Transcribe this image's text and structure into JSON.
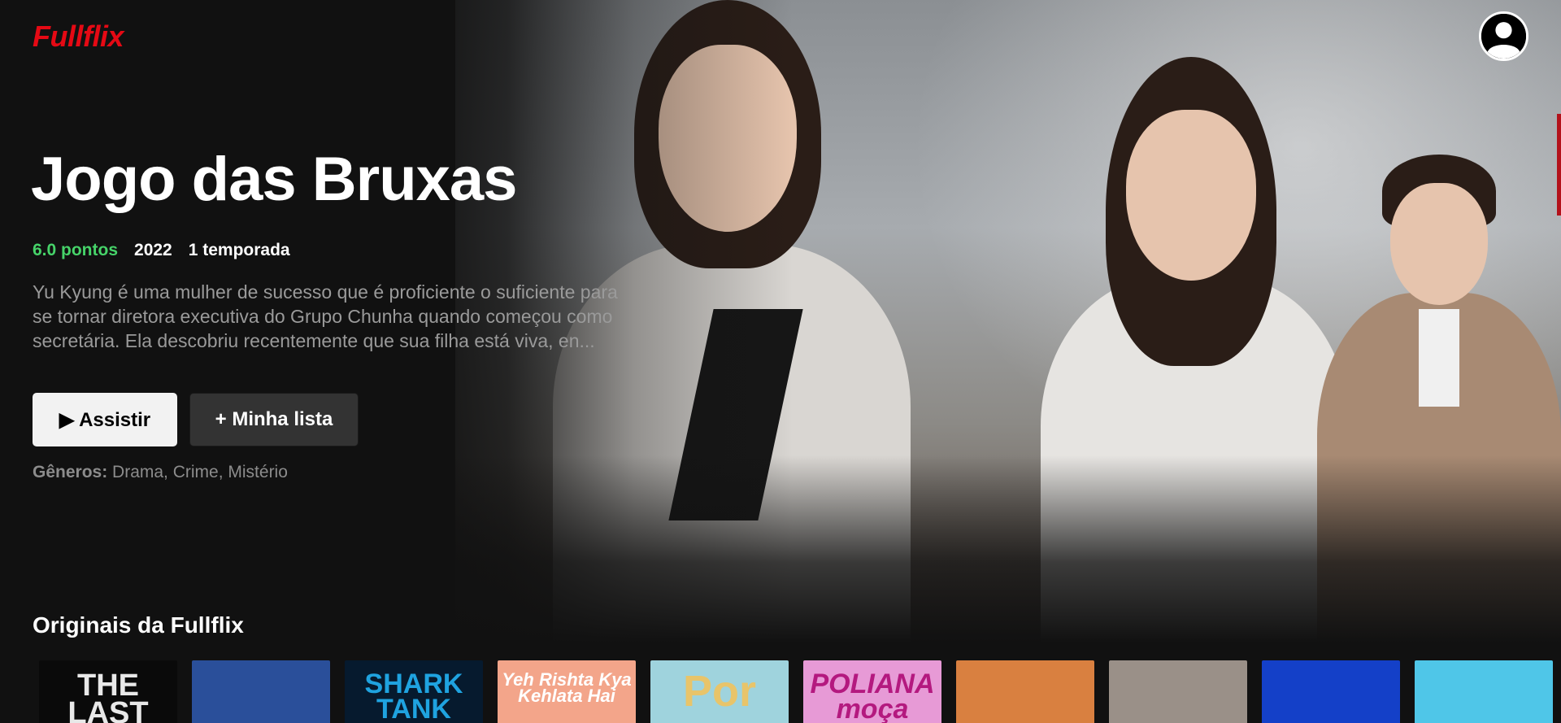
{
  "app": {
    "logo": "Fullflix"
  },
  "header": {
    "profile_icon": "user-circle-icon"
  },
  "featured": {
    "title": "Jogo das Bruxas",
    "score": "6.0 pontos",
    "year": "2022",
    "seasons": "1 temporada",
    "description": "Yu Kyung é uma mulher de sucesso que é proficiente o suficiente para se tornar diretora executiva do Grupo Chunha quando começou como secretária. Ela descobriu recentemente que sua filha está viva, en...",
    "play_label": "▶ Assistir",
    "list_label": "+ Minha lista",
    "genres_label": "Gêneros:",
    "genres": "Drama, Crime, Mistério"
  },
  "row": {
    "title": "Originais da Fullflix",
    "items": [
      {
        "text": "THE LAST",
        "bg": "#0a0a0a",
        "fg": "#e8e8e8"
      },
      {
        "text": "",
        "bg": "#2a4f9a",
        "fg": "#ffffff"
      },
      {
        "text": "SHARK TANK",
        "bg": "#061a2e",
        "fg": "#1fa3e0"
      },
      {
        "text": "Yeh Rishta Kya Kehlata Hai",
        "bg": "#f3a58a",
        "fg": "#ffffff"
      },
      {
        "text": "Por",
        "bg": "#9fd3dd",
        "fg": "#e8c46a"
      },
      {
        "text": "POLIANA moça",
        "bg": "#e79ad6",
        "fg": "#b4197f"
      },
      {
        "text": "",
        "bg": "#d98040",
        "fg": "#ffffff"
      },
      {
        "text": "",
        "bg": "#9a9088",
        "fg": "#ffffff"
      },
      {
        "text": "",
        "bg": "#1440c8",
        "fg": "#ffffff"
      },
      {
        "text": "",
        "bg": "#4fc6e8",
        "fg": "#ffffff"
      }
    ]
  }
}
